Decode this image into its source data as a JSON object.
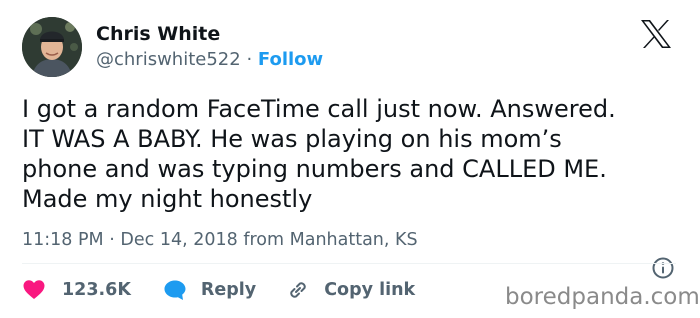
{
  "author": {
    "name": "Chris White",
    "handle": "@chriswhite522",
    "separator": "·",
    "follow_label": "Follow"
  },
  "tweet": {
    "lines": [
      "I got a random FaceTime call just now. Answered.",
      "IT WAS A BABY. He was playing on his mom’s",
      "phone and was typing numbers and CALLED ME.",
      "Made my night honestly"
    ],
    "time": "11:18 PM",
    "separator": "·",
    "date": "Dec 14, 2018",
    "location": "from Manhattan, KS"
  },
  "actions": {
    "likes_count": "123.6K",
    "reply_label": "Reply",
    "copy_link_label": "Copy link"
  },
  "watermark": "boredpanda.com",
  "icons": {
    "logo": "x-logo-icon",
    "like": "heart-icon",
    "reply": "speech-bubble-icon",
    "copy": "link-icon",
    "info": "info-icon"
  },
  "colors": {
    "text": "#0f1419",
    "muted": "#536471",
    "accent": "#1d9bf0",
    "like": "#f91880",
    "divider": "#eff3f4",
    "watermark": "#8a8a8a"
  }
}
